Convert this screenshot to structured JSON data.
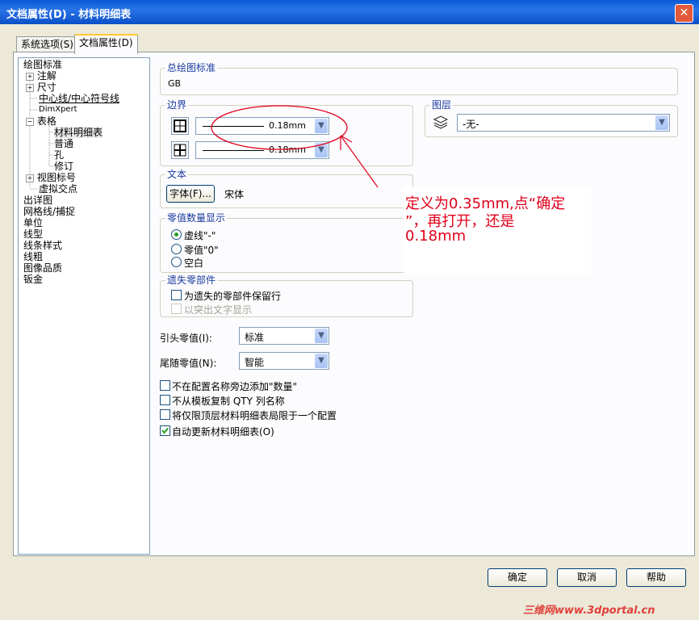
{
  "window": {
    "title": "文档属性(D) - 材料明细表",
    "close": "✕"
  },
  "tabs": [
    {
      "label": "系统选项(S)"
    },
    {
      "label": "文档属性(D)"
    }
  ],
  "tree": [
    {
      "label": "绘图标准"
    },
    {
      "label": "注解"
    },
    {
      "label": "尺寸"
    },
    {
      "label": "中心线/中心符号线"
    },
    {
      "label": "DimXpert"
    },
    {
      "label": "表格"
    },
    {
      "label": "材料明细表"
    },
    {
      "label": "普通"
    },
    {
      "label": "孔"
    },
    {
      "label": "修订"
    },
    {
      "label": "视图标号"
    },
    {
      "label": "虚拟交点"
    },
    {
      "label": "出详图"
    },
    {
      "label": "网格线/捕捉"
    },
    {
      "label": "单位"
    },
    {
      "label": "线型"
    },
    {
      "label": "线条样式"
    },
    {
      "label": "线粗"
    },
    {
      "label": "图像品质"
    },
    {
      "label": "钣金"
    }
  ],
  "general_standard": {
    "title": "总绘图标准",
    "value": "GB"
  },
  "border": {
    "title": "边界",
    "line1_value": "0.18mm",
    "line2_value": "0.18mm"
  },
  "layer": {
    "title": "图层",
    "value": "-无-"
  },
  "text": {
    "title": "文本",
    "font_button": "字体(F)...",
    "font_name": "宋体"
  },
  "zero": {
    "title": "零值数量显示",
    "opt1": "虚线\"-\"",
    "opt2": "零值\"0\"",
    "opt3": "空白"
  },
  "missing": {
    "title": "遗失零部件",
    "keep": "为遗失的零部件保留行",
    "strike": "以突出文字显示"
  },
  "leading_zero": {
    "label": "引头零值(I):",
    "value": "标准"
  },
  "trailing_zero": {
    "label": "尾随零值(N):",
    "value": "智能"
  },
  "checks": [
    {
      "label": "不在配置名称旁边添加\"数量\"",
      "checked": false
    },
    {
      "label": "不从模板复制 QTY 列名称",
      "checked": false
    },
    {
      "label": "将仅限顶层材料明细表局限于一个配置",
      "checked": false
    },
    {
      "label": "自动更新材料明细表(O)",
      "checked": true
    }
  ],
  "buttons": {
    "ok": "确定",
    "cancel": "取消",
    "help": "帮助"
  },
  "annotation": {
    "line1": "定义为0.35mm,点“确定",
    "line2": "”，再打开，还是",
    "line3": "0.18mm"
  },
  "watermark": "三维网www.3dportal.cn",
  "colors": {
    "annotation": "#e0001a",
    "titlebar": "#0a58d6",
    "group_title": "#1a3a9e"
  }
}
